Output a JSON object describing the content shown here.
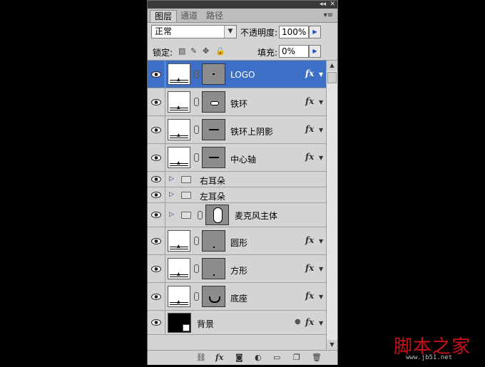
{
  "panel": {
    "top_controls": {
      "collapse": "◂◂",
      "close": "✕"
    },
    "tabs": [
      {
        "label": "图层",
        "active": true
      },
      {
        "label": "通道",
        "active": false
      },
      {
        "label": "路径",
        "active": false
      }
    ],
    "menu_icon": "▾≡",
    "blend_mode": "正常",
    "opacity_label": "不透明度:",
    "opacity_value": "100%",
    "lock_label": "锁定:",
    "fill_label": "填充:",
    "fill_value": "0%"
  },
  "layers": [
    {
      "name": "LOGO",
      "selected": true,
      "fx": "fx",
      "mask": "dot"
    },
    {
      "name": "铁环",
      "selected": false,
      "fx": "fx",
      "mask": "ring"
    },
    {
      "name": "铁环上阴影",
      "selected": false,
      "fx": "fx",
      "mask": "line"
    },
    {
      "name": "中心轴",
      "selected": false,
      "fx": "fx",
      "mask": "line"
    },
    {
      "name": "右耳朵",
      "type": "group"
    },
    {
      "name": "左耳朵",
      "type": "group"
    },
    {
      "name": "麦克风主体",
      "type": "group-mask"
    },
    {
      "name": "圆形",
      "selected": false,
      "fx": "fx",
      "mask": "dot-low"
    },
    {
      "name": "方形",
      "selected": false,
      "fx": "fx",
      "mask": "dot-low"
    },
    {
      "name": "底座",
      "selected": false,
      "fx": "fx",
      "mask": "cup"
    },
    {
      "name": "背景",
      "type": "background",
      "fx": "fx"
    }
  ],
  "watermark": {
    "text": "脚本之家",
    "url": "www.jb51.net"
  },
  "colors": {
    "selected": "#3d6fc6",
    "panel": "#d4d4d4",
    "watermark": "#c8101a"
  }
}
